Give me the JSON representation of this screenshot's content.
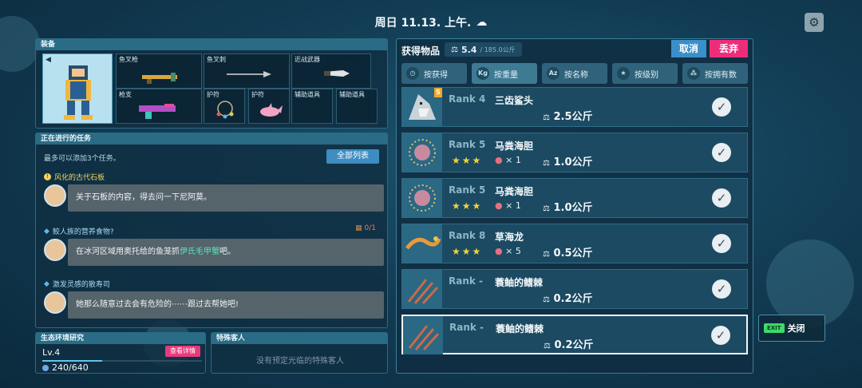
{
  "topbar": {
    "title": "周日 11.13. 上午."
  },
  "equipment": {
    "header": "装备",
    "slots": [
      {
        "label": "鱼叉枪"
      },
      {
        "label": "鱼叉刺"
      },
      {
        "label": "近战武器"
      },
      {
        "label": "枪支"
      },
      {
        "label": "护符"
      },
      {
        "label": "护符"
      },
      {
        "label": "辅助道具"
      },
      {
        "label": "辅助道具"
      }
    ]
  },
  "tasks": {
    "header": "正在进行的任务",
    "subtitle": "最多可以添加3个任务。",
    "list_button": "全部列表",
    "items": [
      {
        "title": "风化的古代石板",
        "text": "关于石板的内容，得去问一下尼阿莫。",
        "color": "#f3d55c"
      },
      {
        "title": "鲛人族的营养食物?",
        "text_before": "在冰河区域用奥托给的鱼笼抓",
        "text_highlight": "伊氏毛甲蟹",
        "text_after": "吧。",
        "count": "0/1"
      },
      {
        "title": "激发灵感的散寿司",
        "text": "她那么随意过去会有危险的⋯⋯跟过去帮她吧!"
      }
    ]
  },
  "eco": {
    "header": "生态环境研究",
    "level": "Lv.4",
    "detail_button": "查看详情",
    "progress_text": "240/640",
    "progress_fraction": 0.375
  },
  "guest": {
    "header": "特殊客人",
    "empty_text": "没有预定光临的特殊客人"
  },
  "items_panel": {
    "title": "获得物品",
    "weight": "5.4",
    "max_weight": "/ 185.0公斤",
    "cancel": "取消",
    "discard": "丢弃",
    "sort_tabs": [
      {
        "label": "按获得",
        "icon": "clock-icon"
      },
      {
        "label": "按重量",
        "icon": "kg-icon"
      },
      {
        "label": "按名称",
        "icon": "az-icon"
      },
      {
        "label": "按级别",
        "icon": "star-icon"
      },
      {
        "label": "按拥有数",
        "icon": "count-icon"
      }
    ],
    "rows": [
      {
        "rank": "Rank 4",
        "name": "三齿鲨头",
        "stars": "",
        "qty": "",
        "weight": "2.5公斤",
        "badge": "S"
      },
      {
        "rank": "Rank 5",
        "name": "马粪海胆",
        "stars": "★★★",
        "qty": "× 1",
        "weight": "1.0公斤"
      },
      {
        "rank": "Rank 5",
        "name": "马粪海胆",
        "stars": "★★★",
        "qty": "× 1",
        "weight": "1.0公斤"
      },
      {
        "rank": "Rank 8",
        "name": "草海龙",
        "stars": "★★★",
        "qty": "× 5",
        "weight": "0.5公斤"
      },
      {
        "rank": "Rank -",
        "name": "蓑鲉的鳍棘",
        "stars": "",
        "qty": "",
        "weight": "0.2公斤"
      },
      {
        "rank": "Rank -",
        "name": "蓑鲉的鳍棘",
        "stars": "",
        "qty": "",
        "weight": "0.2公斤"
      }
    ]
  },
  "close_button": {
    "exit": "EXIT",
    "label": "关闭"
  },
  "colors": {
    "accent": "#3a8fc8",
    "danger": "#ee2d7a",
    "gold": "#f4d23a"
  }
}
